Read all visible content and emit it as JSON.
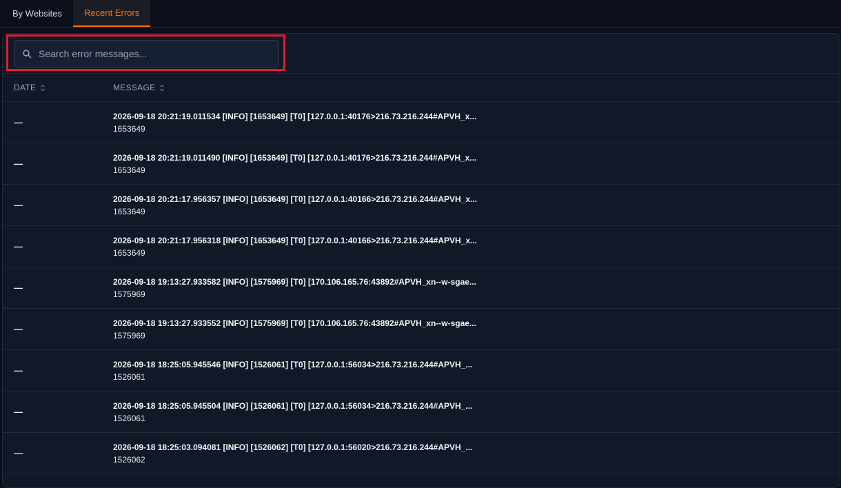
{
  "tabs": [
    {
      "label": "By Websites",
      "active": false
    },
    {
      "label": "Recent Errors",
      "active": true
    }
  ],
  "colors": {
    "accent": "#f97316",
    "highlight": "#e11d2e"
  },
  "search": {
    "placeholder": "Search error messages...",
    "value": ""
  },
  "table": {
    "columns": [
      "DATE",
      "MESSAGE"
    ],
    "rows": [
      {
        "date": "—",
        "message": "2026-09-18 20:21:19.011534 [INFO] [1653649] [T0] [127.0.0.1:40176>216.73.216.244#APVH_x...",
        "sub": "1653649"
      },
      {
        "date": "—",
        "message": "2026-09-18 20:21:19.011490 [INFO] [1653649] [T0] [127.0.0.1:40176>216.73.216.244#APVH_x...",
        "sub": "1653649"
      },
      {
        "date": "—",
        "message": "2026-09-18 20:21:17.956357 [INFO] [1653649] [T0] [127.0.0.1:40166>216.73.216.244#APVH_x...",
        "sub": "1653649"
      },
      {
        "date": "—",
        "message": "2026-09-18 20:21:17.956318 [INFO] [1653649] [T0] [127.0.0.1:40166>216.73.216.244#APVH_x...",
        "sub": "1653649"
      },
      {
        "date": "—",
        "message": "2026-09-18 19:13:27.933582 [INFO] [1575969] [T0] [170.106.165.76:43892#APVH_xn--w-sgae...",
        "sub": "1575969"
      },
      {
        "date": "—",
        "message": "2026-09-18 19:13:27.933552 [INFO] [1575969] [T0] [170.106.165.76:43892#APVH_xn--w-sgae...",
        "sub": "1575969"
      },
      {
        "date": "—",
        "message": "2026-09-18 18:25:05.945546 [INFO] [1526061] [T0] [127.0.0.1:56034>216.73.216.244#APVH_...",
        "sub": "1526061"
      },
      {
        "date": "—",
        "message": "2026-09-18 18:25:05.945504 [INFO] [1526061] [T0] [127.0.0.1:56034>216.73.216.244#APVH_...",
        "sub": "1526061"
      },
      {
        "date": "—",
        "message": "2026-09-18 18:25:03.094081 [INFO] [1526062] [T0] [127.0.0.1:56020>216.73.216.244#APVH_...",
        "sub": "1526062"
      }
    ]
  }
}
